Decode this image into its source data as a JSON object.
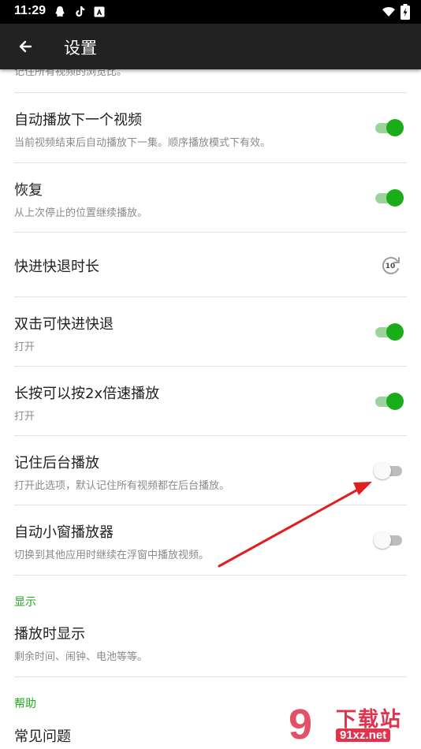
{
  "status_bar": {
    "time": "11:29"
  },
  "app_bar": {
    "title": "设置"
  },
  "partial_text": "记住所有视频的浏览比。",
  "settings": [
    {
      "title": "自动播放下一个视频",
      "subtitle": "当前视频结束后自动播放下一集。顺序播放模式下有效。",
      "toggle": "on"
    },
    {
      "title": "恢复",
      "subtitle": "从上次停止的位置继续播放。",
      "toggle": "on"
    },
    {
      "title": "快进快退时长",
      "icon": "skip-10-seconds-icon",
      "icon_label": "10"
    },
    {
      "title": "双击可快进快退",
      "subtitle": "打开",
      "toggle": "on"
    },
    {
      "title": "长按可以按2x倍速播放",
      "subtitle": "打开",
      "toggle": "on"
    },
    {
      "title": "记住后台播放",
      "subtitle": "打开此选项，默认记住所有视频都在后台播放。",
      "toggle": "off"
    },
    {
      "title": "自动小窗播放器",
      "subtitle": "切换到其他应用时继续在浮窗中播放视频。",
      "toggle": "off"
    }
  ],
  "sections": {
    "display": {
      "header": "显示",
      "items": [
        {
          "title": "播放时显示",
          "subtitle": "剩余时间、闹钟、电池等等。"
        }
      ]
    },
    "help": {
      "header": "帮助",
      "items": [
        {
          "title": "常见问题"
        }
      ]
    }
  },
  "watermark": {
    "logo": "9",
    "name": "下载站",
    "url": "91xz.net"
  },
  "colors": {
    "accent": "#1aad19",
    "app_bar": "#222222",
    "annotation_arrow": "#e02020"
  }
}
